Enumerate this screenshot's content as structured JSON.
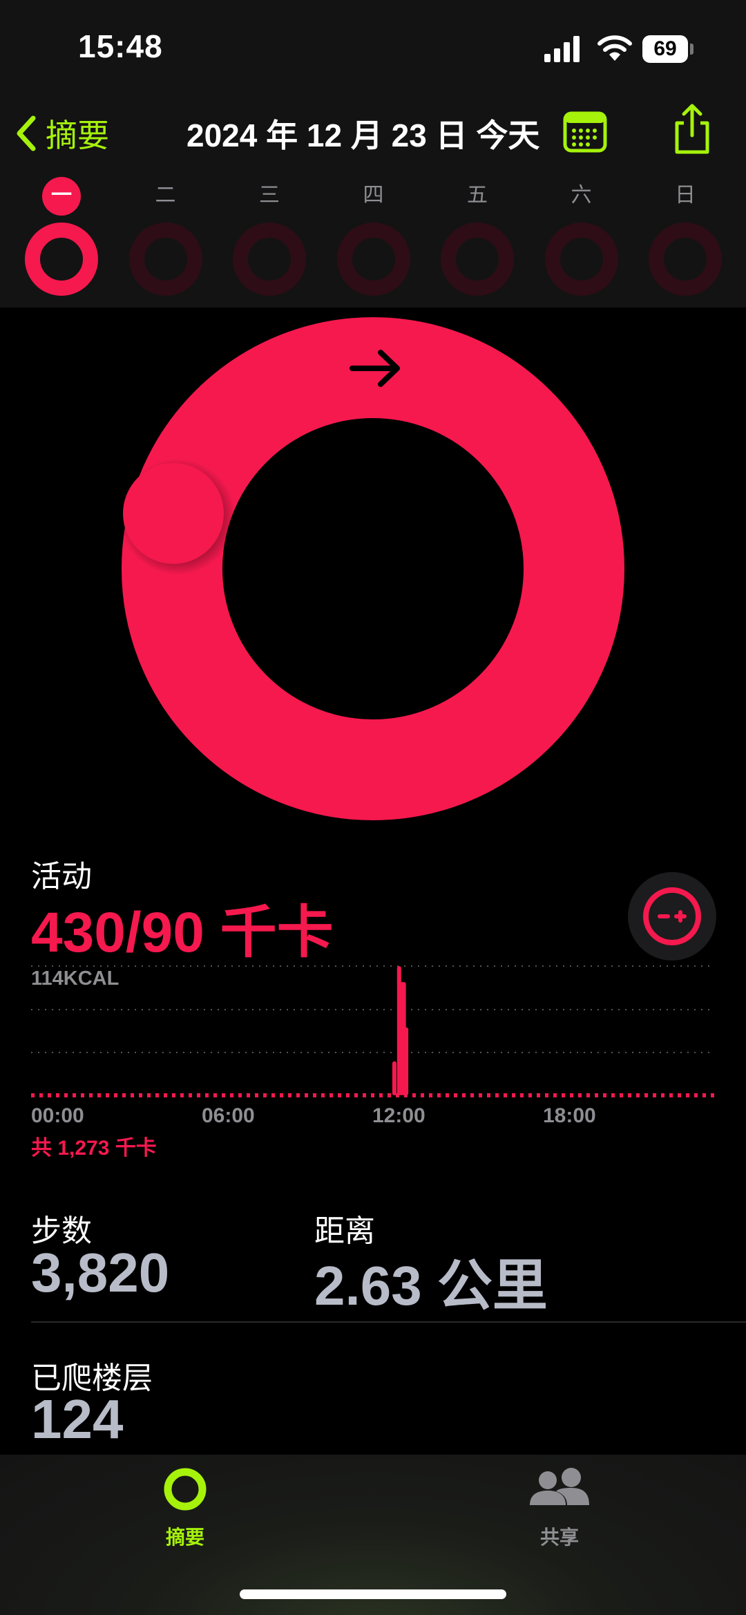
{
  "status_bar": {
    "time": "15:48",
    "battery": "69",
    "icons": [
      "signal-icon",
      "wifi-icon",
      "battery-icon"
    ]
  },
  "header": {
    "back_label": "摘要",
    "date_title": "2024 年 12 月 23 日 今天",
    "calendar_icon": "calendar-icon",
    "share_icon": "share-icon"
  },
  "week": {
    "days": [
      "一",
      "二",
      "三",
      "四",
      "五",
      "六",
      "日"
    ],
    "today_index": 0
  },
  "colors": {
    "move": "#f5194e",
    "move_dim": "#2e0d16",
    "accent": "#a6f20b",
    "stat_value": "#b8bcc8"
  },
  "activity": {
    "title": "活动",
    "value": "430/90 千卡",
    "progress_percent": 478,
    "chart_max_label": "114KCAL",
    "ticks": [
      "00:00",
      "06:00",
      "12:00",
      "18:00"
    ],
    "total": "共 1,273 千卡"
  },
  "chart_data": {
    "type": "bar",
    "x": [
      "12:45",
      "12:55",
      "13:00",
      "13:05",
      "13:10"
    ],
    "values": [
      30,
      114,
      100,
      100,
      60
    ],
    "ylim": [
      0,
      114
    ],
    "xlabel": "",
    "ylabel": "",
    "grid": true
  },
  "stats": {
    "steps_title": "步数",
    "steps_value": "3,820",
    "distance_title": "距离",
    "distance_value": "2.63 公里",
    "floors_title": "已爬楼层",
    "floors_value": "124"
  },
  "tabs": [
    {
      "label": "摘要",
      "icon": "activity-rings-icon",
      "active": true
    },
    {
      "label": "共享",
      "icon": "sharing-people-icon",
      "active": false
    }
  ]
}
